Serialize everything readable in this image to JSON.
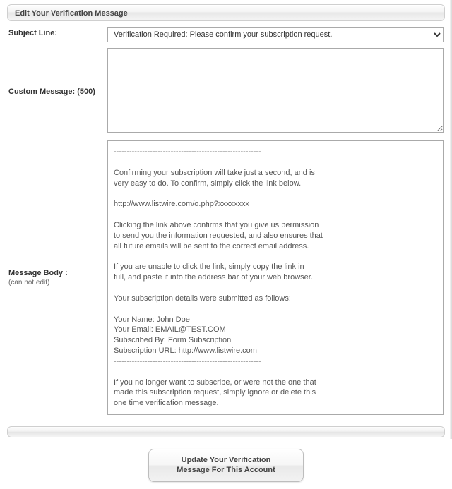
{
  "header": {
    "title": "Edit Your Verification Message"
  },
  "form": {
    "subject": {
      "label": "Subject Line:",
      "selected": "Verification Required: Please confirm your subscription request."
    },
    "custom": {
      "label": "Custom Message: (500)",
      "value": ""
    },
    "body": {
      "label": "Message Body :",
      "sublabel": "(can not edit)",
      "lines": [
        "---------------------------------------------------------",
        "",
        "Confirming your subscription will take just a second, and is",
        "very easy to do. To confirm, simply click the link below.",
        "",
        "http://www.listwire.com/o.php?xxxxxxxx",
        "",
        "Clicking the link above confirms that you give us permission",
        "to send you the information requested, and also ensures that",
        "all future emails will be sent to the correct email address.",
        "",
        "If you are unable to click the link, simply copy the link in",
        "full, and paste it into the address bar of your web browser.",
        "",
        "Your subscription details were submitted as follows:",
        "",
        "Your Name: John Doe",
        "Your Email: EMAIL@TEST.COM",
        "Subscribed By: Form Subscription",
        "Subscription URL: http://www.listwire.com",
        "---------------------------------------------------------",
        "",
        "If you no longer want to subscribe, or were not the one that",
        "made this subscription request, simply ignore or delete this",
        "one time verification message."
      ]
    }
  },
  "actions": {
    "update": "Update Your Verification\nMessage For This Account"
  }
}
